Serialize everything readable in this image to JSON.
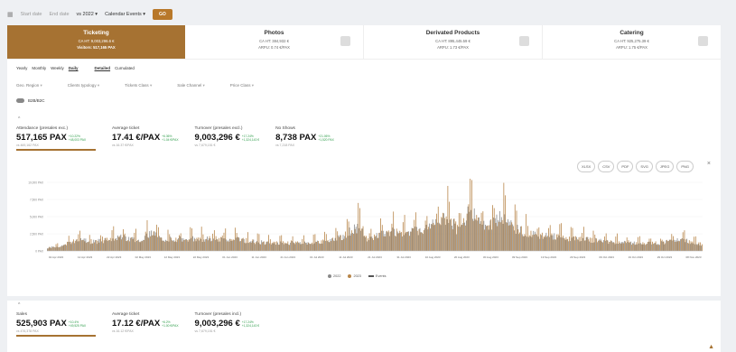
{
  "topbar": {
    "start_date": "Start date",
    "end_date": "End date",
    "compare": "vs 2022",
    "events": "Calendar Events",
    "go": "GO"
  },
  "tiles": [
    {
      "title": "Ticketing",
      "line1": "CA HT: 9,003,296.6 €",
      "line2": "Visitors: 517,165 PAX"
    },
    {
      "title": "Photos",
      "line1": "CA HT: 384,932 €",
      "line2": "ARPU: 0.74 €/PAX"
    },
    {
      "title": "Derivated Products",
      "line1": "CA HT: 895,445.59 €",
      "line2": "ARPU: 1.73 €/PAX"
    },
    {
      "title": "Catering",
      "line1": "CA HT: 925,275.39 €",
      "line2": "ARPU: 1.75 €/PAX"
    }
  ],
  "modes": {
    "yearly": "Yearly",
    "monthly": "Monthly",
    "weekly": "Weekly",
    "daily": "Daily",
    "detailed": "Detailed",
    "cumulated": "Cumulated"
  },
  "filters": [
    "Geo. Region",
    "Clients typology",
    "Tickets Class",
    "Sale Channel",
    "Price Class"
  ],
  "toggle_label": "B2B/B2C",
  "kpis1": [
    {
      "label": "Attendance (presales exc.)",
      "value": "517,165 PAX",
      "d1": "+10.22%",
      "d2": "+48,003 PAX",
      "vs": "vs 469,162 PAX"
    },
    {
      "label": "Average ticket",
      "value": "17.41 €/PAX",
      "d1": "+6.36%",
      "d2": "+1.04 €/PAX",
      "vs": "vs 16.37 €/PAX"
    },
    {
      "label": "Turnover (presales excl.)",
      "value": "9,003,296 €",
      "d1": "+17.24%",
      "d2": "+1,324,143 €",
      "vs": "vs 7,679,151 €"
    },
    {
      "label": "No Shows",
      "value": "8,738 PAX",
      "d1": "+21.06%",
      "d2": "+1,520 PAX",
      "vs": "vs 7,218 PAX"
    }
  ],
  "exports": [
    "XLSX",
    "CSV",
    "PDF",
    "SVG",
    "JPEG",
    "PNG"
  ],
  "close_icon": "×",
  "chart_data": {
    "type": "bar",
    "y_ticks": [
      "10,000 PAX",
      "7,500 PAX",
      "5,000 PAX",
      "2,500 PAX",
      "0 PAX"
    ],
    "ylim": [
      0,
      10000
    ],
    "x_ticks": [
      "02 Apr 2023",
      "12 Apr 2023",
      "22 Apr 2023",
      "02 May 2023",
      "12 May 2023",
      "22 May 2023",
      "01 Jun 2023",
      "11 Jun 2023",
      "21 Jun 2023",
      "01 Jul 2023",
      "11 Jul 2023",
      "21 Jul 2023",
      "31 Jul 2023",
      "10 Aug 2023",
      "20 Aug 2023",
      "30 Aug 2023",
      "09 Sep 2023",
      "19 Sep 2023",
      "29 Sep 2023",
      "09 Oct 2023",
      "19 Oct 2023",
      "29 Oct 2023",
      "08 Nov 2023"
    ],
    "series": [
      {
        "name": "2022",
        "color": "#8a8a8a"
      },
      {
        "name": "2023",
        "color": "#b8864a"
      },
      {
        "name": "Events",
        "color": "#555555"
      }
    ],
    "profile": [
      [
        0,
        600
      ],
      [
        10,
        900
      ],
      [
        18,
        2000
      ],
      [
        30,
        1600
      ],
      [
        45,
        2400
      ],
      [
        58,
        1900
      ],
      [
        65,
        3600
      ],
      [
        72,
        2200
      ],
      [
        90,
        2100
      ],
      [
        110,
        2300
      ],
      [
        135,
        1500
      ],
      [
        160,
        1400
      ],
      [
        180,
        2000
      ],
      [
        196,
        4500
      ],
      [
        200,
        2200
      ],
      [
        215,
        3400
      ],
      [
        235,
        3600
      ],
      [
        250,
        6200
      ],
      [
        256,
        4000
      ],
      [
        265,
        7700
      ],
      [
        272,
        4200
      ],
      [
        285,
        6200
      ],
      [
        293,
        3900
      ],
      [
        305,
        2800
      ],
      [
        320,
        2500
      ],
      [
        340,
        2000
      ],
      [
        355,
        1600
      ],
      [
        370,
        1300
      ],
      [
        385,
        1500
      ],
      [
        395,
        2100
      ],
      [
        410,
        1200
      ]
    ]
  },
  "kpis2": [
    {
      "label": "Sales",
      "value": "525,903 PAX",
      "d1": "+10.4%",
      "d2": "+49,525 PAX",
      "vs": "vs 476,378 PAX"
    },
    {
      "label": "Average ticket",
      "value": "17.12 €/PAX",
      "d1": "+6.2%",
      "d2": "+1.00 €/PAX",
      "vs": "vs 16.12 €/PAX"
    },
    {
      "label": "Turnover (presales incl.)",
      "value": "9,003,296 €",
      "d1": "+17.24%",
      "d2": "+1,324,143 €",
      "vs": "vs 7,679,151 €"
    }
  ],
  "legend_2022": "2022",
  "legend_2023": "2023",
  "legend_events": "Events"
}
